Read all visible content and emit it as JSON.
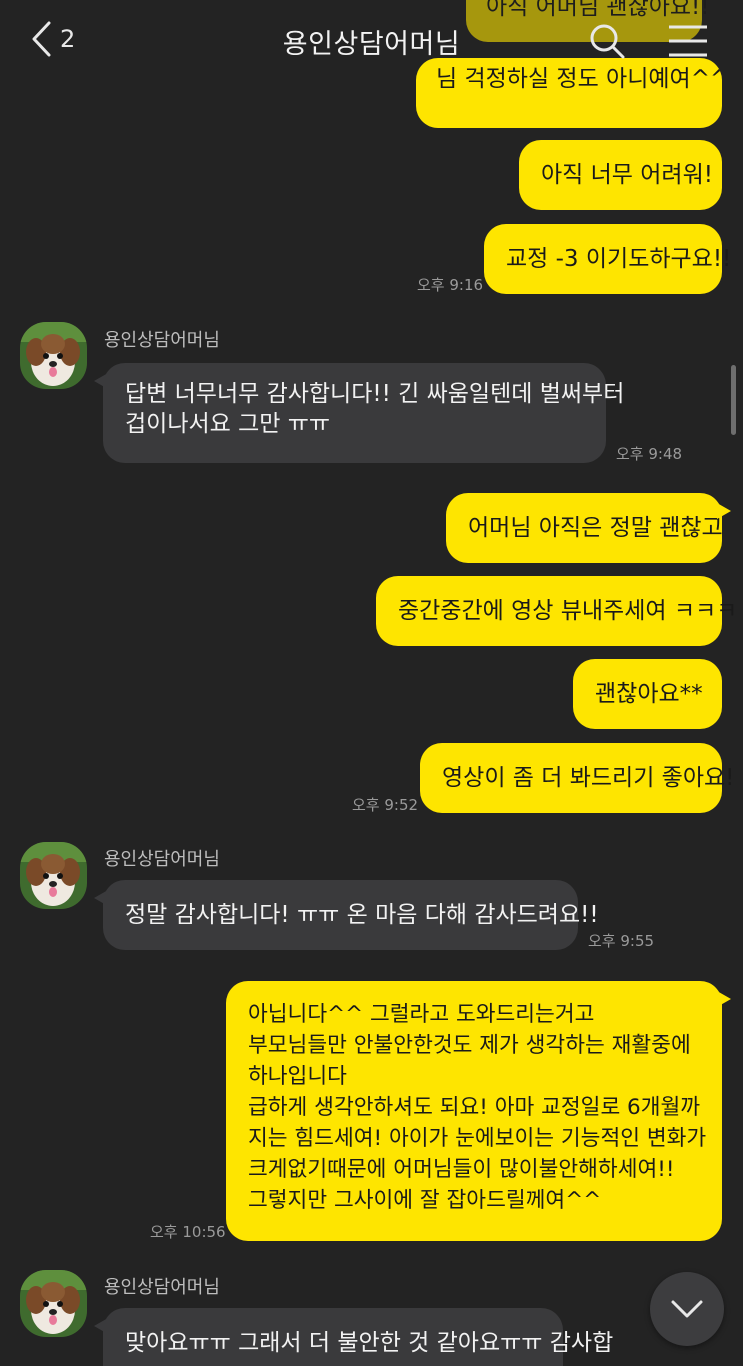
{
  "header": {
    "back_count": "2",
    "title": "용인상담어머님"
  },
  "messages": {
    "top_partial_1": "아직 어머님 괜찮아요!!",
    "top_partial_2": "님 걱정하실 정도 아니예여^^",
    "m1": "아직 너무 어려워!",
    "m2": "교정 -3 이기도하구요!!",
    "t1": "오후 9:16",
    "s1": "용인상담어머님",
    "r1": [
      "답변 너무너무 감사합니다!! 긴 싸움일텐데 벌써부터",
      "겁이나서요 그만 ㅠㅠ"
    ],
    "t2": "오후 9:48",
    "m3": "어머님 아직은 정말 괜찮고",
    "m4": "중간중간에 영상 뷰내주세여 ㅋㅋㅋ",
    "m5": "괜찮아요**",
    "m6": "영상이 좀 더 봐드리기 좋아요!",
    "t3": "오후 9:52",
    "s2": "용인상담어머님",
    "r2": "정말 감사합니다! ㅠㅠ 온 마음 다해 감사드려요!!",
    "t4": "오후 9:55",
    "m7": [
      "아닙니다^^ 그럴라고 도와드리는거고",
      "부모님들만 안불안한것도 제가 생각하는 재활중에",
      "하나입니다",
      "급하게 생각안하셔도 되요! 아마 교정일로 6개월까",
      "지는 힘드세여! 아이가 눈에보이는 기능적인 변화가",
      "크게없기때문에 어머님들이 많이불안해하세여!!",
      "그렇지만 그사이에 잘 잡아드릴께여^^"
    ],
    "t5": "오후 10:56",
    "s3": "용인상담어머님",
    "r3": "맞아요ㅠㅠ 그래서 더 불안한 것 같아요ㅠㅠ 감사합"
  },
  "colors": {
    "background": "#232323",
    "my_bubble": "#fee500",
    "their_bubble": "#3a3a3c"
  },
  "icons": {
    "back": "chevron-left-icon",
    "search": "search-icon",
    "menu": "hamburger-menu-icon",
    "scroll_down": "chevron-down-icon",
    "avatar": "dog-photo"
  }
}
